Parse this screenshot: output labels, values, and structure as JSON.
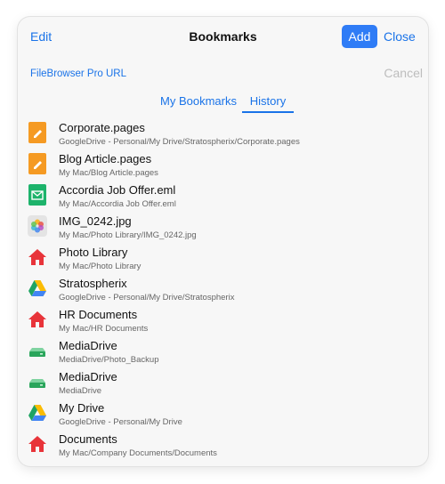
{
  "navbar": {
    "edit_label": "Edit",
    "title": "Bookmarks",
    "add_label": "Add",
    "close_label": "Close"
  },
  "url_row": {
    "label": "FileBrowser Pro URL",
    "cancel_label": "Cancel"
  },
  "tabs": [
    {
      "label": "My Bookmarks",
      "selected": false
    },
    {
      "label": "History",
      "selected": true
    }
  ],
  "colors": {
    "accent": "#1a73e8",
    "add_button": "#2f7cf6",
    "pages_icon": "#f59a23",
    "eml_icon": "#1db36b",
    "folder_icon": "#e8343a",
    "drive_icon": "#2aa55b"
  },
  "items": [
    {
      "name": "Corporate.pages",
      "path": "GoogleDrive - Personal/My Drive/Stratospherix/Corporate.pages",
      "icon": "pages-icon"
    },
    {
      "name": "Blog Article.pages",
      "path": "My Mac/Blog Article.pages",
      "icon": "pages-icon"
    },
    {
      "name": "Accordia Job Offer.eml",
      "path": "My Mac/Accordia Job Offer.eml",
      "icon": "email-icon"
    },
    {
      "name": "IMG_0242.jpg",
      "path": "My Mac/Photo Library/IMG_0242.jpg",
      "icon": "photos-icon"
    },
    {
      "name": "Photo Library",
      "path": "My Mac/Photo Library",
      "icon": "house-icon"
    },
    {
      "name": "Stratospherix",
      "path": "GoogleDrive - Personal/My Drive/Stratospherix",
      "icon": "google-drive-icon"
    },
    {
      "name": "HR Documents",
      "path": "My Mac/HR Documents",
      "icon": "house-icon"
    },
    {
      "name": "MediaDrive",
      "path": "MediaDrive/Photo_Backup",
      "icon": "hard-drive-icon"
    },
    {
      "name": "MediaDrive",
      "path": "MediaDrive",
      "icon": "hard-drive-icon"
    },
    {
      "name": "My Drive",
      "path": "GoogleDrive - Personal/My Drive",
      "icon": "google-drive-icon"
    },
    {
      "name": "Documents",
      "path": "My Mac/Company Documents/Documents",
      "icon": "house-icon"
    }
  ]
}
